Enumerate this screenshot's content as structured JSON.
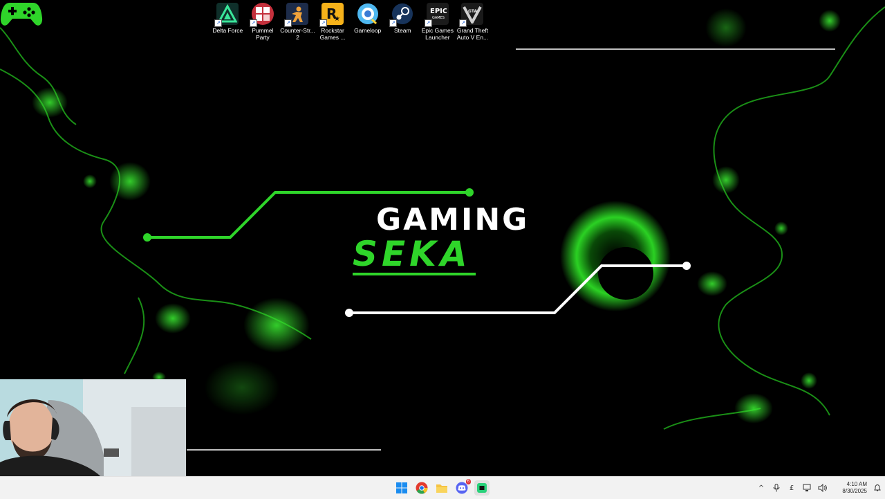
{
  "desktop": {
    "icons": [
      {
        "label": "Delta Force",
        "icon": "delta-force-icon"
      },
      {
        "label": "Pummel Party",
        "icon": "pummel-party-icon"
      },
      {
        "label": "Counter-Str... 2",
        "icon": "counter-strike-icon"
      },
      {
        "label": "Rockstar Games ...",
        "icon": "rockstar-icon"
      },
      {
        "label": "Gameloop",
        "icon": "gameloop-icon"
      },
      {
        "label": "Steam",
        "icon": "steam-icon"
      },
      {
        "label": "Epic Games Launcher",
        "icon": "epic-games-icon"
      },
      {
        "label": "Grand Theft Auto V En...",
        "icon": "gta-v-icon"
      }
    ]
  },
  "wallpaper": {
    "title_top": "GAMING",
    "title_bottom": "SEKA",
    "accent_color": "#2fd52a"
  },
  "taskbar": {
    "apps": [
      "windows-start-icon",
      "chrome-icon",
      "file-explorer-icon",
      "discord-icon",
      "streaming-app-icon"
    ],
    "discord_badge": "6",
    "tray": {
      "overflow": "^",
      "language": "£",
      "time": "4:10 AM",
      "date": "8/30/2025"
    }
  }
}
